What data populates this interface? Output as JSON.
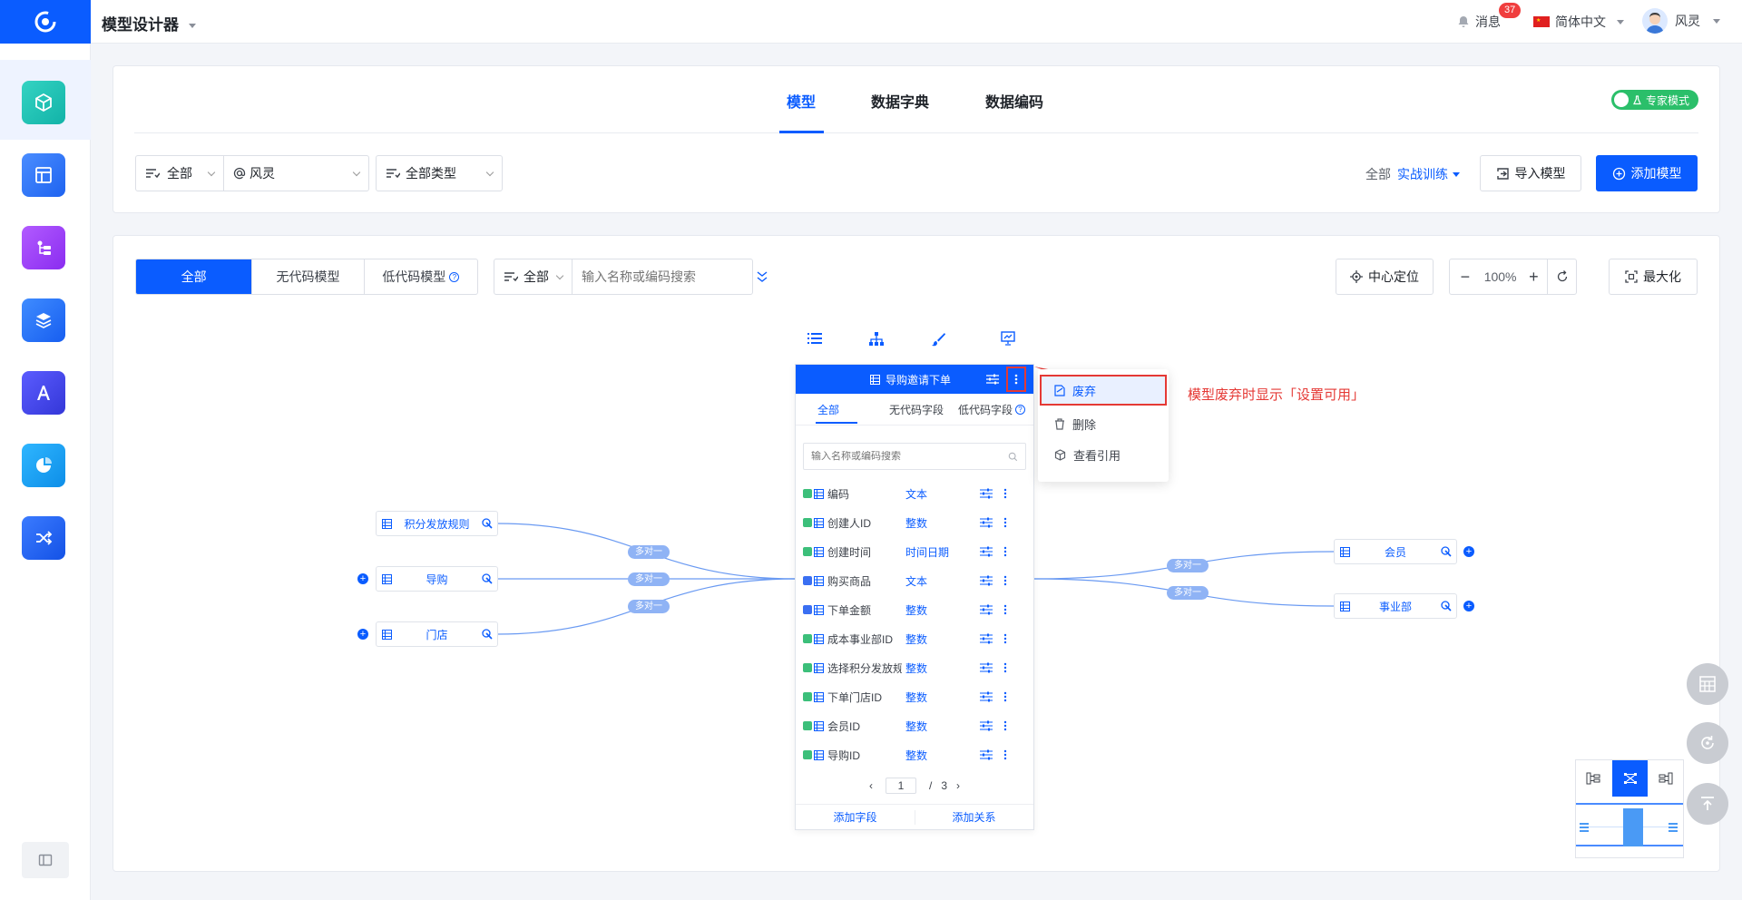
{
  "header": {
    "app_title": "模型设计器",
    "messages_label": "消息",
    "messages_count": "37",
    "language": "简体中文",
    "user_name": "风灵"
  },
  "top_card": {
    "tabs": [
      "模型",
      "数据字典",
      "数据编码"
    ],
    "active_tab": "模型",
    "expert_mode_label": "专家模式",
    "filter_scope": "全部",
    "filter_owner": "风灵",
    "filter_type": "全部类型",
    "env_prefix": "全部",
    "env_value": "实战训练",
    "import_label": "导入模型",
    "add_label": "添加模型"
  },
  "canvas_toolbar": {
    "segments": [
      "全部",
      "无代码模型",
      "低代码模型"
    ],
    "active_segment": "全部",
    "filter_select": "全部",
    "search_placeholder": "输入名称或编码搜索",
    "center_label": "中心定位",
    "zoom": "100%",
    "maximize_label": "最大化"
  },
  "main_model": {
    "title": "导购邀请下单",
    "tabs": [
      "全部",
      "无代码字段",
      "低代码字段"
    ],
    "active_tab": "全部",
    "search_placeholder": "输入名称或编码搜索",
    "fields": [
      {
        "name": "编码",
        "type": "文本",
        "kind": "green"
      },
      {
        "name": "创建人ID",
        "type": "整数",
        "kind": "green"
      },
      {
        "name": "创建时间",
        "type": "时间日期",
        "kind": "green"
      },
      {
        "name": "购买商品",
        "type": "文本",
        "kind": "blue"
      },
      {
        "name": "下单金额",
        "type": "整数",
        "kind": "blue"
      },
      {
        "name": "成本事业部ID",
        "type": "整数",
        "kind": "green"
      },
      {
        "name": "选择积分发放规",
        "type": "整数",
        "kind": "green"
      },
      {
        "name": "下单门店ID",
        "type": "整数",
        "kind": "green"
      },
      {
        "name": "会员ID",
        "type": "整数",
        "kind": "green"
      },
      {
        "name": "导购ID",
        "type": "整数",
        "kind": "green"
      }
    ],
    "page_current": "1",
    "page_sep": "/",
    "page_total": "3",
    "add_field_label": "添加字段",
    "add_relation_label": "添加关系"
  },
  "context_menu": {
    "items": [
      "废弃",
      "删除",
      "查看引用"
    ],
    "highlighted": "废弃"
  },
  "annotation": "模型废弃时显示「设置可用」",
  "left_nodes": [
    "积分发放规则",
    "导购",
    "门店"
  ],
  "right_nodes": [
    "会员",
    "事业部"
  ],
  "relation_label": "多对一",
  "colors": {
    "primary": "#0a5cff",
    "annotation": "#e53935",
    "relation_pill": "#8fb3f5"
  }
}
